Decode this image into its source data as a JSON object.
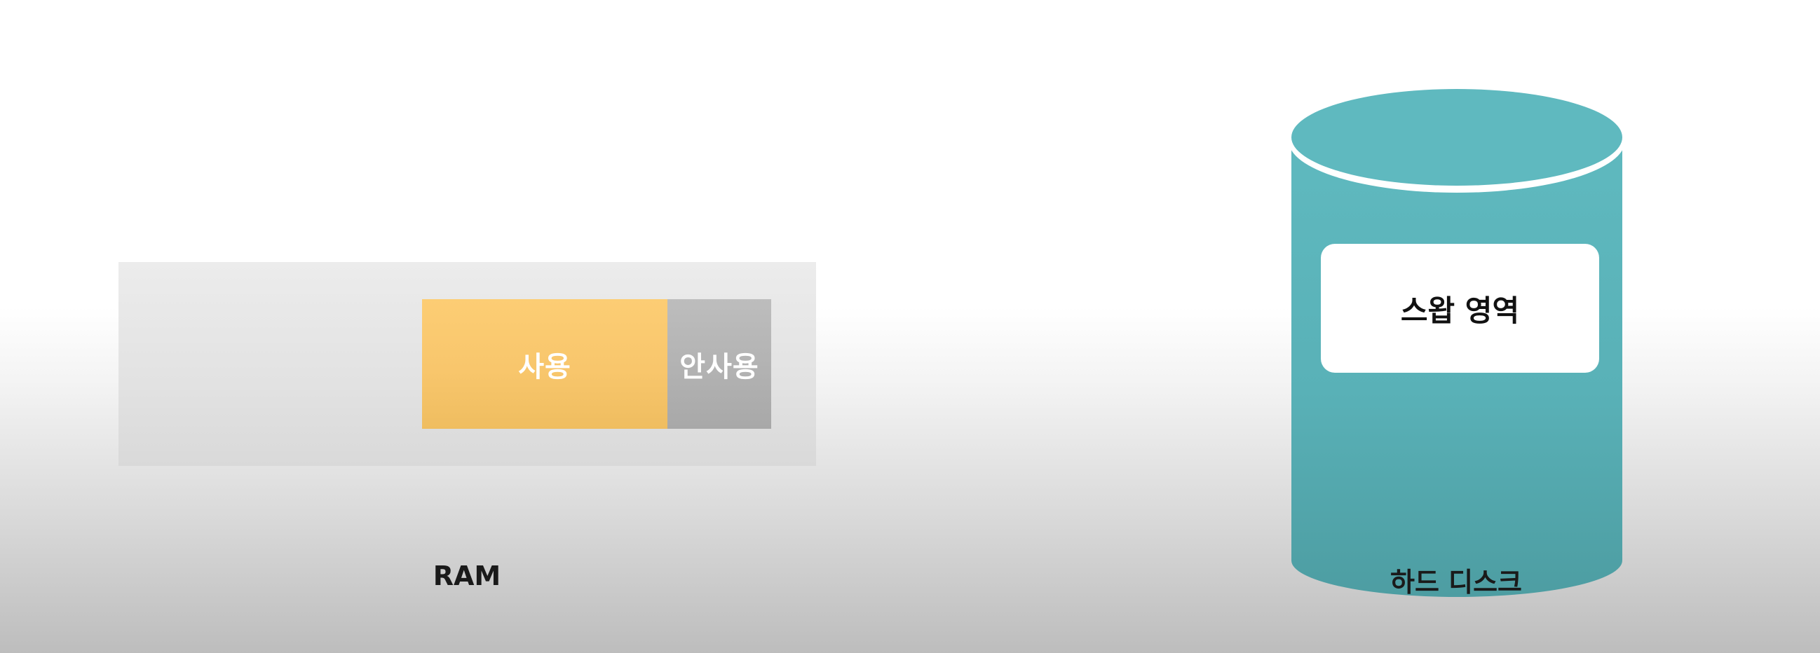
{
  "ram": {
    "used_label": "사용",
    "unused_label": "안사용",
    "caption": "RAM"
  },
  "disk": {
    "swap_label": "스왑 영역",
    "caption": "하드 디스크"
  },
  "colors": {
    "used": "#f8c66c",
    "unused": "#b1b1b1",
    "disk": "#5fb9bf",
    "ram_container": "#e2e2e2"
  }
}
